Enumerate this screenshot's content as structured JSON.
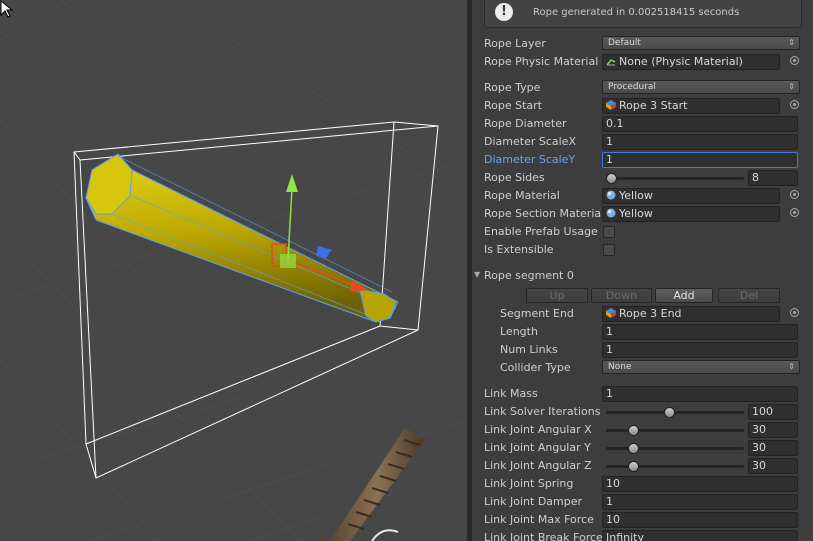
{
  "viewport": {
    "colors": {
      "rope": "#c8b400",
      "selection": "#5aa0ff",
      "gizmo_y": "#8ee53f",
      "gizmo_x": "#e64b1b",
      "gizmo_z": "#3a6ff0"
    }
  },
  "inspector": {
    "info": {
      "icon": "info-icon",
      "text": "Rope generated in 0.002518415 seconds"
    },
    "rope_layer": {
      "label": "Rope Layer",
      "value": "Default"
    },
    "rope_physic_material": {
      "label": "Rope Physic Material",
      "value": "None (Physic Material)"
    },
    "rope_type": {
      "label": "Rope Type",
      "value": "Procedural"
    },
    "rope_start": {
      "label": "Rope Start",
      "value": "Rope 3 Start"
    },
    "rope_diameter": {
      "label": "Rope Diameter",
      "value": "0.1"
    },
    "diameter_scale_x": {
      "label": "Diameter ScaleX",
      "value": "1"
    },
    "diameter_scale_y": {
      "label": "Diameter ScaleY",
      "value": "1"
    },
    "rope_sides": {
      "label": "Rope Sides",
      "value": "8",
      "level": 0.0
    },
    "rope_material": {
      "label": "Rope Material",
      "value": "Yellow"
    },
    "rope_section_material": {
      "label": "Rope Section Material",
      "value": "Yellow"
    },
    "enable_prefab_usage": {
      "label": "Enable Prefab Usage",
      "checked": false
    },
    "is_extensible": {
      "label": "Is Extensible",
      "checked": false
    },
    "segment": {
      "title": "Rope segment 0",
      "buttons": {
        "up": "Up",
        "down": "Down",
        "add": "Add",
        "del": "Del"
      },
      "segment_end": {
        "label": "Segment End",
        "value": "Rope 3 End"
      },
      "length": {
        "label": "Length",
        "value": "1"
      },
      "num_links": {
        "label": "Num Links",
        "value": "1"
      },
      "collider_type": {
        "label": "Collider Type",
        "value": "None"
      }
    },
    "link_mass": {
      "label": "Link Mass",
      "value": "1"
    },
    "link_solver_iterations": {
      "label": "Link Solver Iterations",
      "value": "100",
      "level": 0.45
    },
    "link_joint_angular_x": {
      "label": "Link Joint Angular X",
      "value": "30",
      "level": 0.17
    },
    "link_joint_angular_y": {
      "label": "Link Joint Angular Y",
      "value": "30",
      "level": 0.17
    },
    "link_joint_angular_z": {
      "label": "Link Joint Angular Z",
      "value": "30",
      "level": 0.17
    },
    "link_joint_spring": {
      "label": "Link Joint Spring",
      "value": "10"
    },
    "link_joint_damper": {
      "label": "Link Joint Damper",
      "value": "1"
    },
    "link_joint_max_force": {
      "label": "Link Joint Max Force",
      "value": "10"
    },
    "link_joint_break_force": {
      "label": "Link Joint Break Force",
      "value": "Infinity"
    }
  }
}
